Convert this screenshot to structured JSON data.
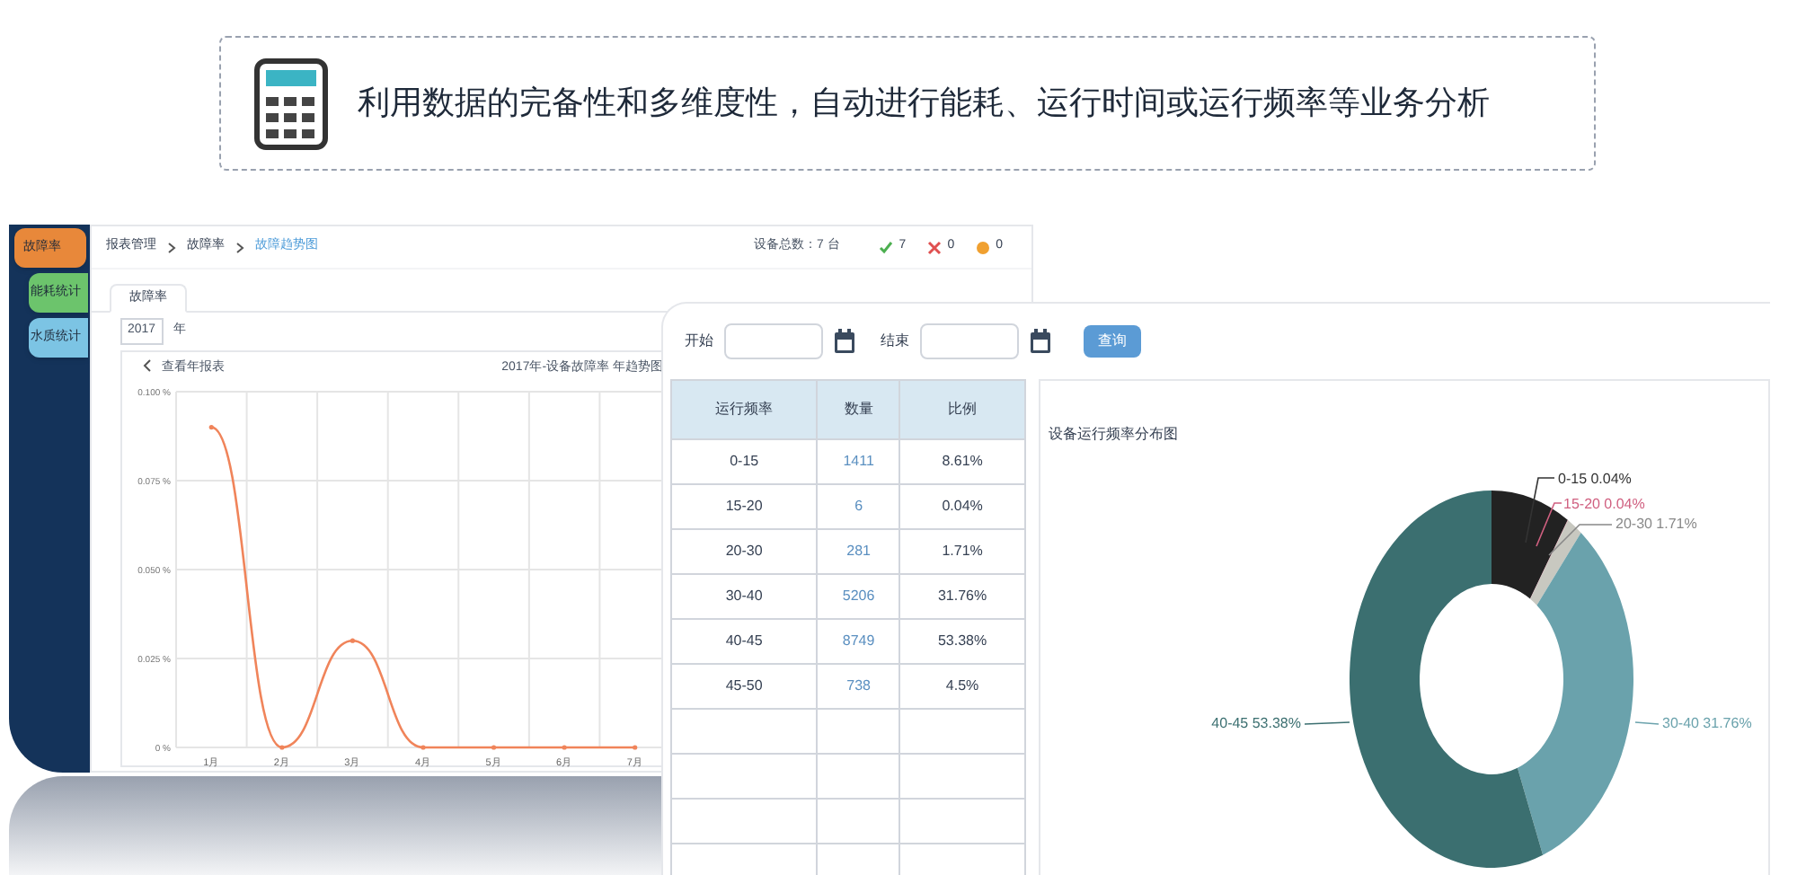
{
  "banner": {
    "text": "利用数据的完备性和多维度性，自动进行能耗、运行时间或运行频率等业务分析"
  },
  "sidebar": {
    "tabs": [
      {
        "label": "故障率",
        "selected": true,
        "color": "#e8883a"
      },
      {
        "label": "能耗统计",
        "selected": false,
        "color": "#6cc46c"
      },
      {
        "label": "水质统计",
        "selected": false,
        "color": "#7cc4e4"
      }
    ]
  },
  "report": {
    "breadcrumb": [
      {
        "label": "报表管理",
        "selected": false
      },
      {
        "label": "故障率",
        "selected": false
      },
      {
        "label": "故障趋势图",
        "selected": true
      }
    ],
    "device_total": "设备总数：7 台",
    "status_counts": [
      {
        "kind": "ok",
        "count": "7"
      },
      {
        "kind": "fault",
        "count": "0"
      },
      {
        "kind": "warn",
        "count": "0"
      }
    ],
    "tabs": [
      {
        "label": "故障率",
        "selected": true
      }
    ],
    "year": {
      "value": "2017",
      "unit": "年"
    },
    "back_link": "查看年报表",
    "chart_data": {
      "type": "line",
      "title": "2017年-设备故障率 年趋势图",
      "categories": [
        "1月",
        "2月",
        "3月",
        "4月",
        "5月",
        "6月",
        "7月"
      ],
      "grid": true,
      "series": [
        {
          "color": "#f0845a",
          "values": [
            0.09,
            0,
            0.03,
            0,
            0,
            0,
            0
          ]
        }
      ],
      "ylim": [
        0,
        0.1
      ],
      "yticks": [
        {
          "value": 0,
          "label": "0 %"
        },
        {
          "value": 0.025,
          "label": "0.025 %"
        },
        {
          "value": 0.05,
          "label": "0.050 %"
        },
        {
          "value": 0.075,
          "label": "0.075 %"
        },
        {
          "value": 0.1,
          "label": "0.100 %"
        }
      ]
    }
  },
  "query": {
    "start_label": "开始",
    "end_label": "结束",
    "button": "查询"
  },
  "table": {
    "columns": [
      "运行频率",
      "数量",
      "比例"
    ],
    "rows": [
      [
        "0-15",
        "1411",
        "8.61%"
      ],
      [
        "15-20",
        "6",
        "0.04%"
      ],
      [
        "20-30",
        "281",
        "1.71%"
      ],
      [
        "30-40",
        "5206",
        "31.76%"
      ],
      [
        "40-45",
        "8749",
        "53.38%"
      ],
      [
        "45-50",
        "738",
        "4.5%"
      ]
    ]
  },
  "pie": {
    "chart_data": {
      "type": "donut",
      "title": "设备运行频率分布图",
      "categories": [
        "0-15",
        "15-20",
        "20-30",
        "30-40",
        "40-45"
      ],
      "values": [
        9.02,
        0.04,
        1.79,
        33.26,
        55.89
      ]
    },
    "slices": [
      {
        "color": "#222222"
      },
      {
        "color": "#d06080"
      },
      {
        "color": "#c8c8c0"
      },
      {
        "color": "#6aa2ac"
      },
      {
        "color": "#3b6f70"
      }
    ],
    "callouts": [
      {
        "value_label": "0.04%",
        "color": "#333333"
      },
      {
        "value_label": "0.04%",
        "color": "#d06080"
      },
      {
        "value_label": "1.71%",
        "color": "#888888"
      },
      {
        "value_label": "31.76%",
        "color": "#6aa2ac"
      },
      {
        "value_label": "53.38%",
        "color": "#3b6f70"
      }
    ]
  }
}
